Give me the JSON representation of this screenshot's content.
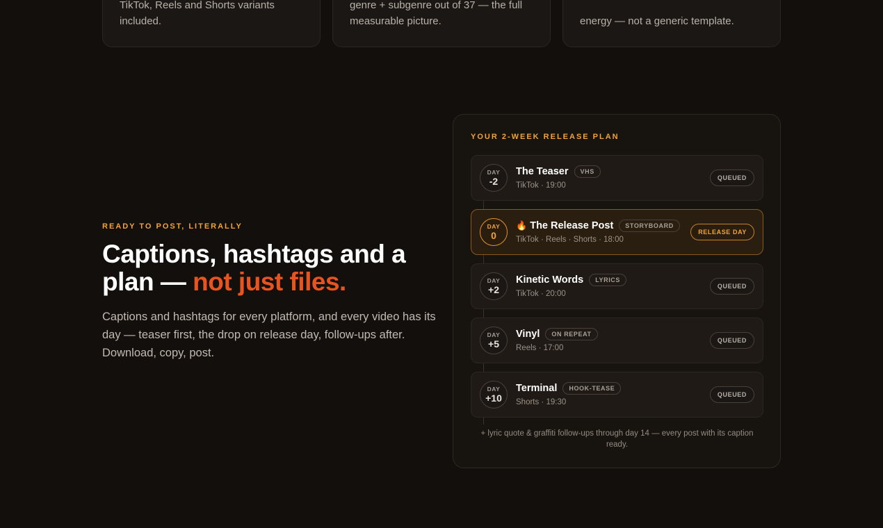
{
  "top_cards": [
    {
      "text": "TikTok, Reels and Shorts variants included."
    },
    {
      "text": "genre + subgenre out of 37 — the full measurable picture."
    },
    {
      "text": "energy — not a generic template."
    }
  ],
  "section": {
    "eyebrow": "READY TO POST, LITERALLY",
    "headline_main": "Captions, hashtags and a plan — ",
    "headline_accent": "not just files.",
    "lede": "Captions and hashtags for every platform, and every video has its day — teaser first, the drop on release day, follow-ups after. Download, copy, post."
  },
  "plan": {
    "title": "YOUR 2-WEEK RELEASE PLAN",
    "rows": [
      {
        "day_label": "DAY",
        "day_num": "-2",
        "name": "The Teaser",
        "tag": "VHS",
        "meta": "TikTok · 19:00",
        "status": "QUEUED"
      },
      {
        "day_label": "DAY",
        "day_num": "0",
        "icon": "🔥",
        "name": "The Release Post",
        "tag": "STORYBOARD",
        "meta": "TikTok · Reels · Shorts · 18:00",
        "status": "RELEASE DAY"
      },
      {
        "day_label": "DAY",
        "day_num": "+2",
        "name": "Kinetic Words",
        "tag": "LYRICS",
        "meta": "TikTok · 20:00",
        "status": "QUEUED"
      },
      {
        "day_label": "DAY",
        "day_num": "+5",
        "name": "Vinyl",
        "tag": "ON REPEAT",
        "meta": "Reels · 17:00",
        "status": "QUEUED"
      },
      {
        "day_label": "DAY",
        "day_num": "+10",
        "name": "Terminal",
        "tag": "HOOK-TEASE",
        "meta": "Shorts · 19:30",
        "status": "QUEUED"
      }
    ],
    "footnote": "+ lyric quote & graffiti follow-ups through day 14 — every post with its caption ready."
  },
  "colors": {
    "accent_orange": "#f0a33c",
    "accent_red": "#e8541e",
    "background": "#130f0d"
  }
}
